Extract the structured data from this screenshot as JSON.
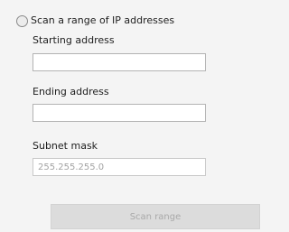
{
  "scan_range": {
    "option_label": "Scan a range of IP addresses",
    "selected": false,
    "starting_address": {
      "label": "Starting address",
      "value": ""
    },
    "ending_address": {
      "label": "Ending address",
      "value": ""
    },
    "subnet_mask": {
      "label": "Subnet mask",
      "value": "255.255.255.0"
    },
    "scan_button_label": "Scan range",
    "scan_button_enabled": false
  }
}
